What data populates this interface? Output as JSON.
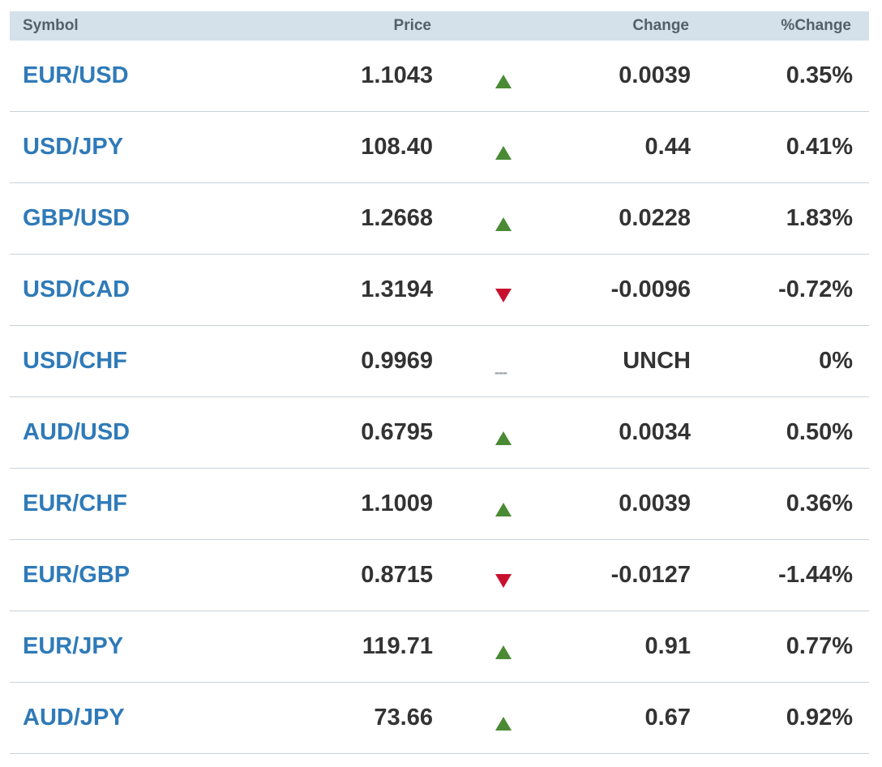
{
  "header": {
    "symbol": "Symbol",
    "price": "Price",
    "change": "Change",
    "pct_change": "%Change"
  },
  "colors": {
    "header_bg": "#d4e1ea",
    "symbol_link": "#2f7ab8",
    "up": "#4a8a35",
    "down": "#c8102e",
    "unchanged": "#9aa0a6"
  },
  "rows": [
    {
      "symbol": "EUR/USD",
      "price": "1.1043",
      "direction": "up",
      "dir_icon": "up-arrow-icon",
      "change": "0.0039",
      "pct": "0.35%"
    },
    {
      "symbol": "USD/JPY",
      "price": "108.40",
      "direction": "up",
      "dir_icon": "up-arrow-icon",
      "change": "0.44",
      "pct": "0.41%"
    },
    {
      "symbol": "GBP/USD",
      "price": "1.2668",
      "direction": "up",
      "dir_icon": "up-arrow-icon",
      "change": "0.0228",
      "pct": "1.83%"
    },
    {
      "symbol": "USD/CAD",
      "price": "1.3194",
      "direction": "down",
      "dir_icon": "down-arrow-icon",
      "change": "-0.0096",
      "pct": "-0.72%"
    },
    {
      "symbol": "USD/CHF",
      "price": "0.9969",
      "direction": "unch",
      "dir_icon": "unchanged-dash-icon",
      "unch_glyph": "---",
      "change": "UNCH",
      "pct": "0%"
    },
    {
      "symbol": "AUD/USD",
      "price": "0.6795",
      "direction": "up",
      "dir_icon": "up-arrow-icon",
      "change": "0.0034",
      "pct": "0.50%"
    },
    {
      "symbol": "EUR/CHF",
      "price": "1.1009",
      "direction": "up",
      "dir_icon": "up-arrow-icon",
      "change": "0.0039",
      "pct": "0.36%"
    },
    {
      "symbol": "EUR/GBP",
      "price": "0.8715",
      "direction": "down",
      "dir_icon": "down-arrow-icon",
      "change": "-0.0127",
      "pct": "-1.44%"
    },
    {
      "symbol": "EUR/JPY",
      "price": "119.71",
      "direction": "up",
      "dir_icon": "up-arrow-icon",
      "change": "0.91",
      "pct": "0.77%"
    },
    {
      "symbol": "AUD/JPY",
      "price": "73.66",
      "direction": "up",
      "dir_icon": "up-arrow-icon",
      "change": "0.67",
      "pct": "0.92%"
    }
  ]
}
